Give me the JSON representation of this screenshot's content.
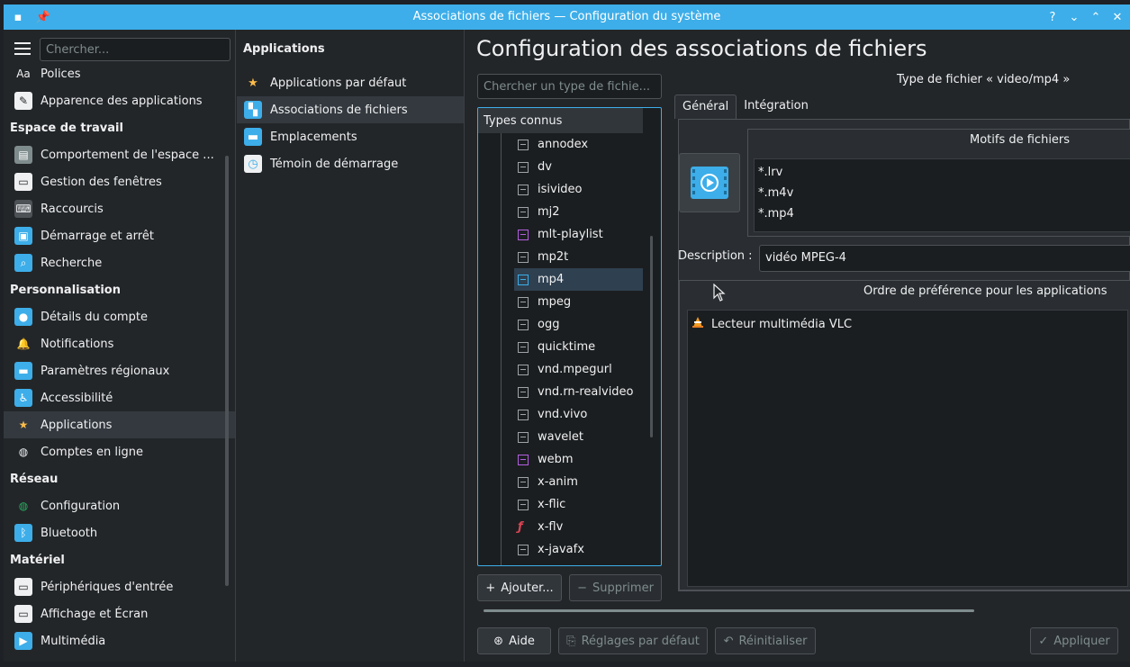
{
  "window": {
    "title": "Associations de fichiers — Configuration du système",
    "buttons": [
      "?",
      "⌄",
      "⌃",
      "✕"
    ]
  },
  "sidebar": {
    "search_placeholder": "Chercher...",
    "items": [
      {
        "type": "item",
        "label": "Polices",
        "icon": "fonts-icon"
      },
      {
        "type": "item",
        "label": "Apparence des applications",
        "icon": "brush-icon"
      },
      {
        "type": "category",
        "label": "Espace de travail"
      },
      {
        "type": "item",
        "label": "Comportement de l'espace ...",
        "icon": "workspace-icon"
      },
      {
        "type": "item",
        "label": "Gestion des fenêtres",
        "icon": "window-icon"
      },
      {
        "type": "item",
        "label": "Raccourcis",
        "icon": "keyboard-icon"
      },
      {
        "type": "item",
        "label": "Démarrage et arrêt",
        "icon": "startup-icon"
      },
      {
        "type": "item",
        "label": "Recherche",
        "icon": "search-icon"
      },
      {
        "type": "category",
        "label": "Personnalisation"
      },
      {
        "type": "item",
        "label": "Détails du compte",
        "icon": "user-icon"
      },
      {
        "type": "item",
        "label": "Notifications",
        "icon": "bell-icon"
      },
      {
        "type": "item",
        "label": "Paramètres régionaux",
        "icon": "region-icon"
      },
      {
        "type": "item",
        "label": "Accessibilité",
        "icon": "accessibility-icon"
      },
      {
        "type": "item",
        "label": "Applications",
        "icon": "star-icon",
        "active": true
      },
      {
        "type": "item",
        "label": "Comptes en ligne",
        "icon": "globe-icon"
      },
      {
        "type": "category",
        "label": "Réseau"
      },
      {
        "type": "item",
        "label": "Configuration",
        "icon": "network-icon"
      },
      {
        "type": "item",
        "label": "Bluetooth",
        "icon": "bluetooth-icon"
      },
      {
        "type": "category",
        "label": "Matériel"
      },
      {
        "type": "item",
        "label": "Périphériques d'entrée",
        "icon": "input-device-icon"
      },
      {
        "type": "item",
        "label": "Affichage et Écran",
        "icon": "display-icon"
      },
      {
        "type": "item",
        "label": "Multimédia",
        "icon": "multimedia-icon"
      }
    ]
  },
  "apps_column": {
    "title": "Applications",
    "items": [
      {
        "label": "Applications par défaut",
        "icon": "star-icon"
      },
      {
        "label": "Associations de fichiers",
        "icon": "file-assoc-icon",
        "active": true
      },
      {
        "label": "Emplacements",
        "icon": "folder-icon"
      },
      {
        "label": "Témoin de démarrage",
        "icon": "launch-feedback-icon"
      }
    ]
  },
  "main": {
    "title": "Configuration des associations de fichiers",
    "type_search_placeholder": "Chercher un type de fichie...",
    "filetype_label": "Type de fichier « video/mp4 »",
    "tree": {
      "header": "Types connus",
      "items": [
        {
          "label": "annodex",
          "icon": "film"
        },
        {
          "label": "dv",
          "icon": "film"
        },
        {
          "label": "isivideo",
          "icon": "film"
        },
        {
          "label": "mj2",
          "icon": "film"
        },
        {
          "label": "mlt-playlist",
          "icon": "purple"
        },
        {
          "label": "mp2t",
          "icon": "film"
        },
        {
          "label": "mp4",
          "icon": "blue",
          "active": true
        },
        {
          "label": "mpeg",
          "icon": "film"
        },
        {
          "label": "ogg",
          "icon": "film"
        },
        {
          "label": "quicktime",
          "icon": "film"
        },
        {
          "label": "vnd.mpegurl",
          "icon": "film"
        },
        {
          "label": "vnd.rn-realvideo",
          "icon": "film"
        },
        {
          "label": "vnd.vivo",
          "icon": "film"
        },
        {
          "label": "wavelet",
          "icon": "film"
        },
        {
          "label": "webm",
          "icon": "purple"
        },
        {
          "label": "x-anim",
          "icon": "film"
        },
        {
          "label": "x-flic",
          "icon": "film"
        },
        {
          "label": "x-flv",
          "icon": "flash"
        },
        {
          "label": "x-javafx",
          "icon": "film"
        }
      ]
    },
    "add_button": "Ajouter...",
    "remove_button": "Supprimer",
    "tabs": [
      {
        "label": "Général",
        "active": true
      },
      {
        "label": "Intégration"
      }
    ],
    "patterns_title": "Motifs de fichiers",
    "patterns": [
      "*.lrv",
      "*.m4v",
      "*.mp4"
    ],
    "description_label": "Description :",
    "description_value": "vidéo MPEG-4",
    "pref_title": "Ordre de préférence pour les applications",
    "pref_apps": [
      {
        "label": "Lecteur multimédia VLC",
        "icon": "vlc-icon"
      }
    ]
  },
  "footer": {
    "help": "Aide",
    "defaults": "Réglages par défaut",
    "reset": "Réinitialiser",
    "apply": "Appliquer"
  }
}
